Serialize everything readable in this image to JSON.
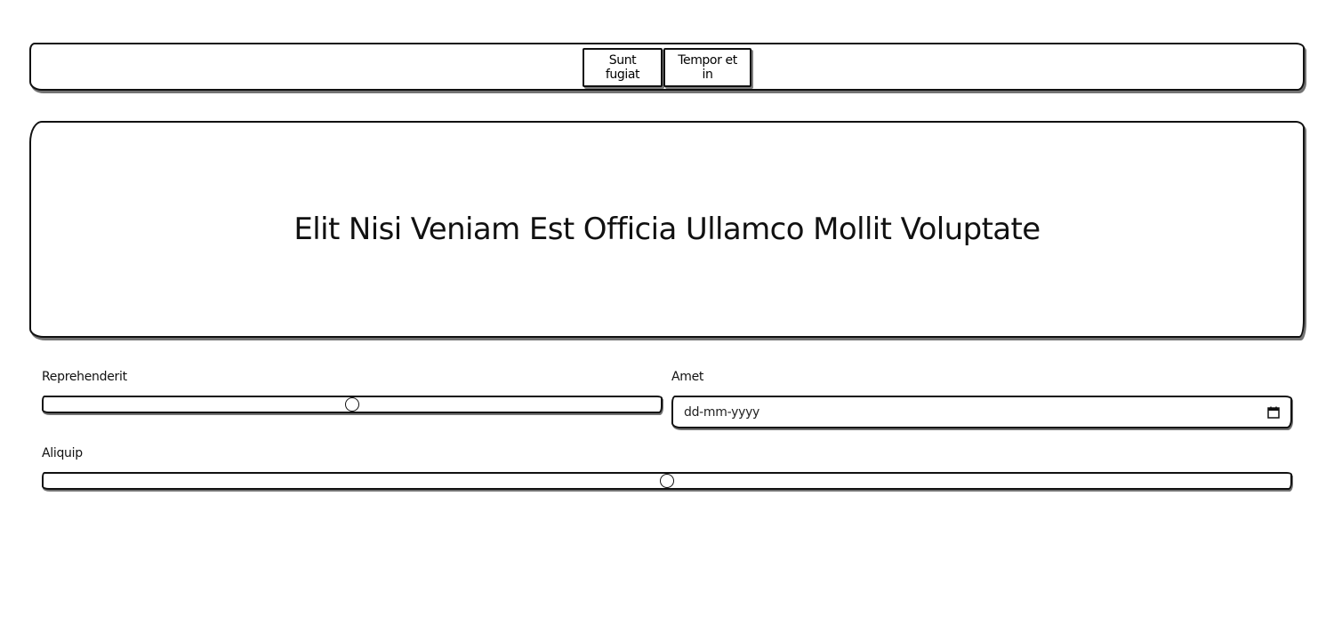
{
  "nav": {
    "buttons": [
      {
        "label": "Sunt fugiat"
      },
      {
        "label": "Tempor et in"
      }
    ]
  },
  "hero": {
    "title": "Elit Nisi Veniam Est Officia Ullamco Mollit Voluptate"
  },
  "form": {
    "reprehenderit": {
      "label": "Reprehenderit",
      "value_fraction": 0.5
    },
    "amet": {
      "label": "Amet",
      "placeholder": "dd-mm-yyyy",
      "icon": "calendar-icon"
    },
    "aliquip": {
      "label": "Aliquip",
      "value_fraction": 0.5
    }
  }
}
